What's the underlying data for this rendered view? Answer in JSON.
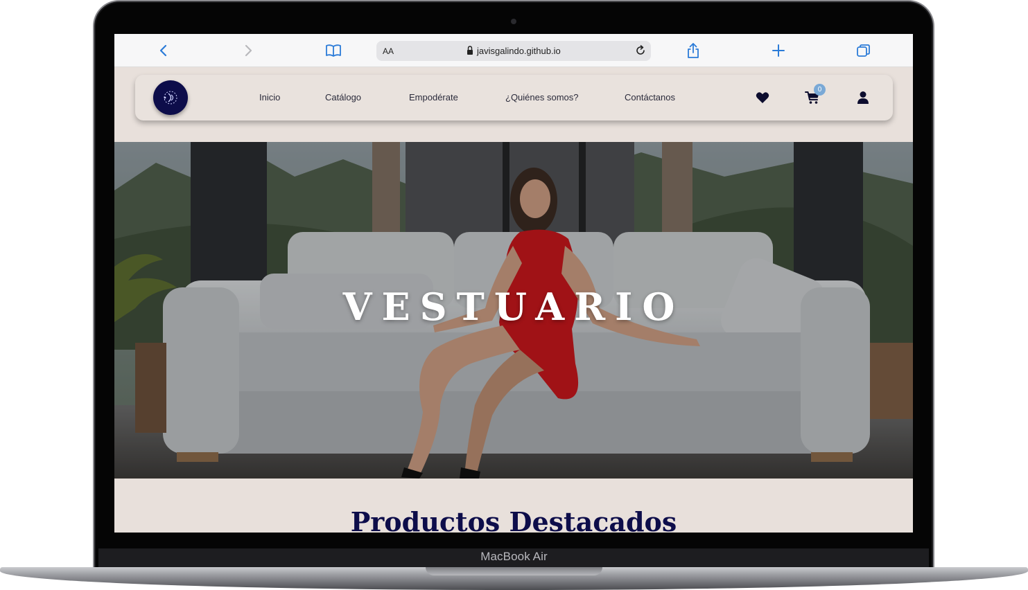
{
  "device": {
    "label": "MacBook Air"
  },
  "browser": {
    "url_prefix": "AA",
    "url": "javisgalindo.github.io",
    "icons": [
      "back-icon",
      "forward-icon",
      "bookmarks-icon",
      "lock-icon",
      "reload-icon",
      "share-icon",
      "new-tab-icon",
      "tabs-icon"
    ]
  },
  "nav": {
    "links": [
      "Inicio",
      "Catálogo",
      "Empodérate",
      "¿Quiénes somos?",
      "Contáctanos"
    ],
    "cart_count": "0",
    "icons": [
      "logo-icon",
      "heart-icon",
      "cart-icon",
      "user-icon"
    ]
  },
  "hero": {
    "title": "VESTUARIO"
  },
  "featured": {
    "title": "Productos Destacados"
  },
  "colors": {
    "brand_navy": "#0d0d4a",
    "page_bg": "#e8e0db",
    "accent_blue": "#2b7bd8",
    "badge_blue": "#7aa9d6",
    "dress_red": "#c4161c"
  }
}
